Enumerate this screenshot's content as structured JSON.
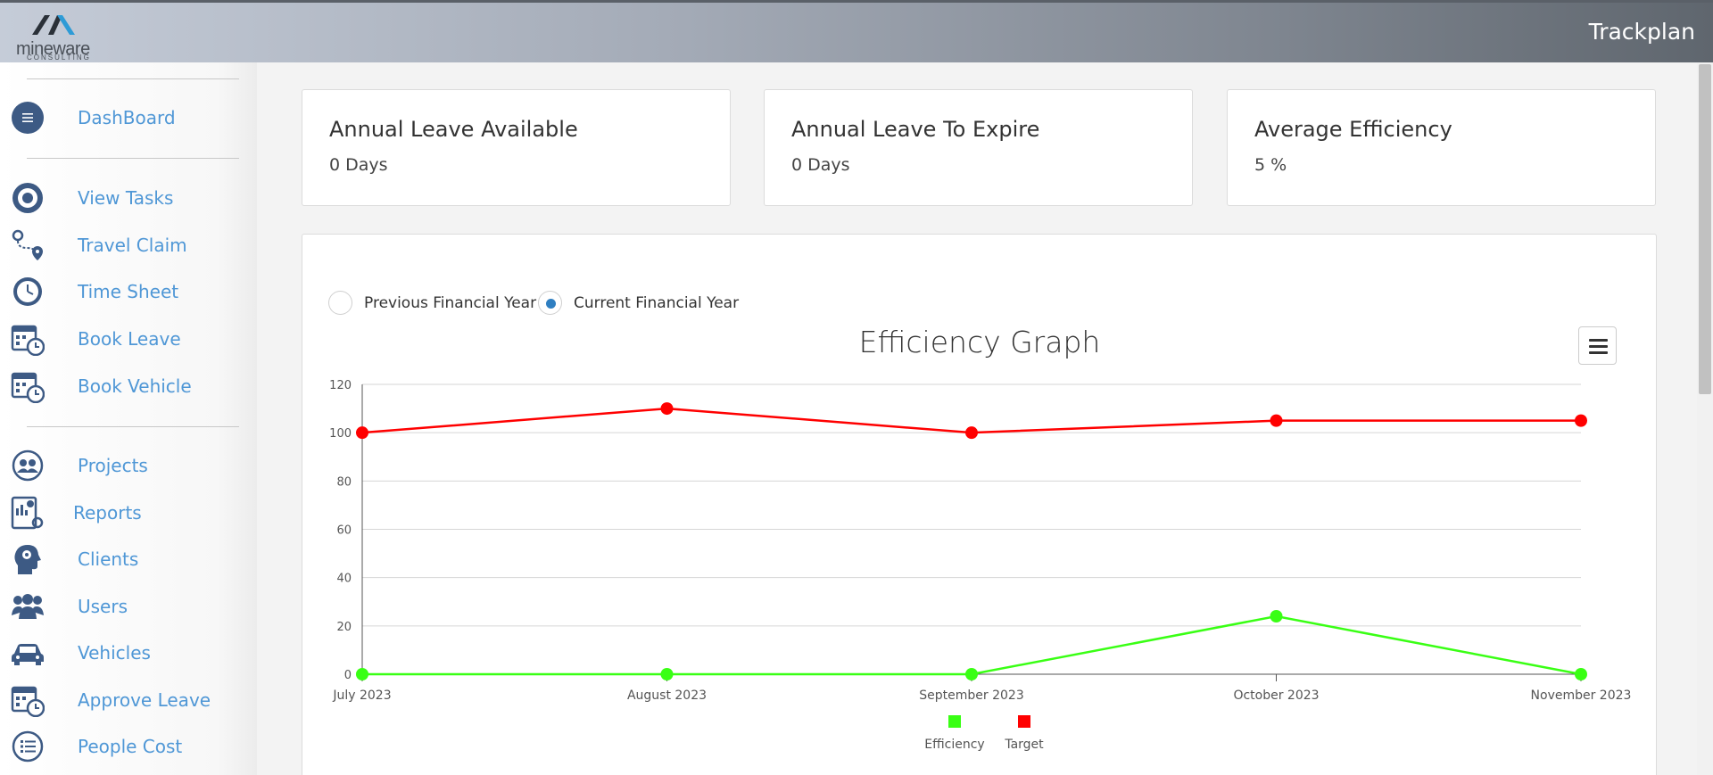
{
  "header": {
    "logo_text": "mineware",
    "logo_subtext": "CONSULTING",
    "title": "Trackplan"
  },
  "sidebar": {
    "items": [
      {
        "label": "DashBoard",
        "icon": "dashboard-icon"
      },
      {
        "label": "View Tasks",
        "icon": "target-icon"
      },
      {
        "label": "Travel Claim",
        "icon": "route-icon"
      },
      {
        "label": "Time Sheet",
        "icon": "clock-icon"
      },
      {
        "label": "Book Leave",
        "icon": "calendar-clock-icon"
      },
      {
        "label": "Book Vehicle",
        "icon": "calendar-clock-icon"
      },
      {
        "label": "Projects",
        "icon": "projects-icon"
      },
      {
        "label": "Reports",
        "icon": "report-icon"
      },
      {
        "label": "Clients",
        "icon": "head-gear-icon"
      },
      {
        "label": "Users",
        "icon": "users-icon"
      },
      {
        "label": "Vehicles",
        "icon": "car-icon"
      },
      {
        "label": "Approve Leave",
        "icon": "calendar-clock-icon"
      },
      {
        "label": "People Cost",
        "icon": "list-icon"
      }
    ]
  },
  "stats": [
    {
      "title": "Annual Leave Available",
      "value": "0 Days"
    },
    {
      "title": "Annual Leave To Expire",
      "value": "0 Days"
    },
    {
      "title": "Average Efficiency",
      "value": "5 %"
    }
  ],
  "filters": {
    "previous_label": "Previous Financial Year",
    "current_label": "Current Financial Year",
    "selected": "current"
  },
  "colors": {
    "accent": "#4f97d6",
    "efficiency": "#39ff14",
    "target": "#ff0000",
    "radio_selected": "#2f7fc1"
  },
  "chart_data": {
    "type": "line",
    "title": "Efficiency Graph",
    "categories": [
      "July 2023",
      "August 2023",
      "September 2023",
      "October 2023",
      "November 2023"
    ],
    "series": [
      {
        "name": "Efficiency",
        "color": "#39ff14",
        "values": [
          0,
          0,
          0,
          24,
          0
        ]
      },
      {
        "name": "Target",
        "color": "#ff0000",
        "values": [
          100,
          110,
          100,
          105,
          105
        ]
      }
    ],
    "y_ticks": [
      "0",
      "20",
      "40",
      "60",
      "80",
      "100",
      "120"
    ],
    "ylim": [
      0,
      120
    ],
    "grid": true,
    "legend_position": "bottom"
  }
}
